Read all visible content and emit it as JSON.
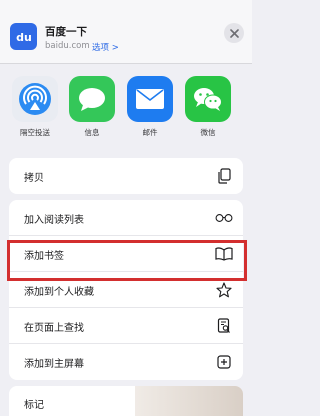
{
  "header": {
    "title": "百度一下",
    "domain": "baidu.com",
    "options": "选项 >",
    "icon_text": "du"
  },
  "share_targets": [
    {
      "label": "隔空投送",
      "icon": "airdrop-icon"
    },
    {
      "label": "信息",
      "icon": "messages-icon"
    },
    {
      "label": "邮件",
      "icon": "mail-icon"
    },
    {
      "label": "微信",
      "icon": "wechat-icon"
    }
  ],
  "actions": {
    "copy": "拷贝",
    "add_reading_list": "加入阅读列表",
    "add_bookmark": "添加书签",
    "add_favorites": "添加到个人收藏",
    "find_on_page": "在页面上查找",
    "add_home_screen": "添加到主屏幕",
    "markup": "标记"
  },
  "colors": {
    "highlight": "#d32f2f",
    "link": "#2e6be6"
  }
}
